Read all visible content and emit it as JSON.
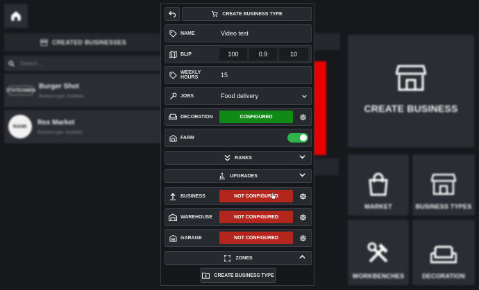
{
  "home": {
    "icon": "home-icon"
  },
  "created_list": {
    "header": "Created Businesses",
    "search_placeholder": "Search...",
    "items": [
      {
        "name": "Burger Shot",
        "type": "Business type: Dudalala",
        "logo": "STATESMEN"
      },
      {
        "name": "Rex Market",
        "type": "Business type: Dudalala",
        "logo": "RANK"
      }
    ]
  },
  "modal": {
    "title": "Create business type",
    "name_label": "Name",
    "name_value": "Video test",
    "blip_label": "Blip",
    "blip_values": [
      "100",
      "0.9",
      "10"
    ],
    "hours_label": "Weekly hours",
    "hours_value": "15",
    "jobs_label": "Jobs",
    "jobs_value": "Food delivery",
    "decoration_label": "Decoration",
    "decoration_status": "Configured",
    "farm_label": "Farm",
    "farm_enabled": true,
    "ranks_label": "Ranks",
    "upgrades_label": "Upgrades",
    "business_label": "Business",
    "business_status": "Not configured",
    "warehouse_label": "Warehouse",
    "warehouse_status": "Not configured",
    "garage_label": "Garage",
    "garage_status": "Not configured",
    "zones_label": "Zones",
    "create_button": "Create business type"
  },
  "tiles": {
    "create_business": "Create business",
    "market": "Market",
    "business_types": "Business types",
    "workbenches": "Workbenches",
    "decoration": "Decoration"
  },
  "colors": {
    "configured": "#0f8a16",
    "not_configured": "#b3261e",
    "toggle_on": "#2fb34a",
    "accent_red": "#e60000"
  }
}
